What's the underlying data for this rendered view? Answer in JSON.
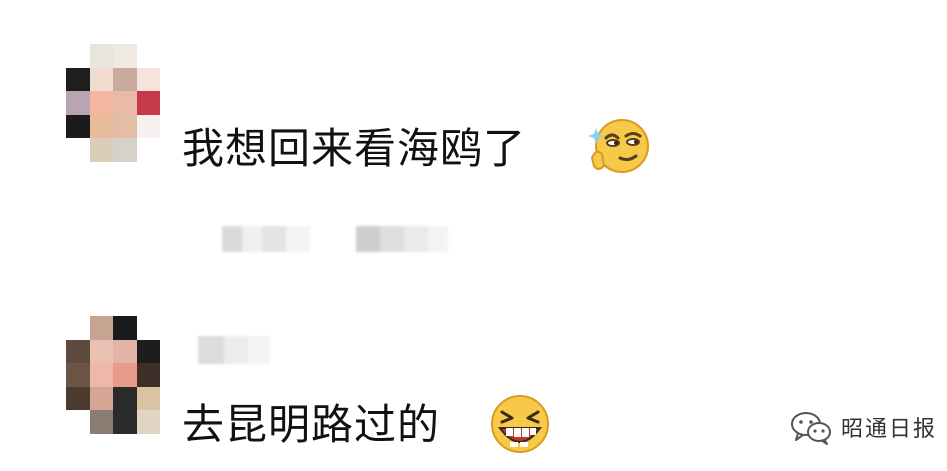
{
  "comments": [
    {
      "text": "我想回来看海鸥了",
      "emoji": "smirk-thinking-emoji"
    },
    {
      "text": "去昆明路过的",
      "emoji": "grinning-laughing-emoji"
    }
  ],
  "watermark": {
    "text": "昭通日报",
    "icon": "wechat-icon"
  },
  "colors": {
    "text": "#111111",
    "background": "#ffffff",
    "emoji_yellow": "#f7c948"
  }
}
